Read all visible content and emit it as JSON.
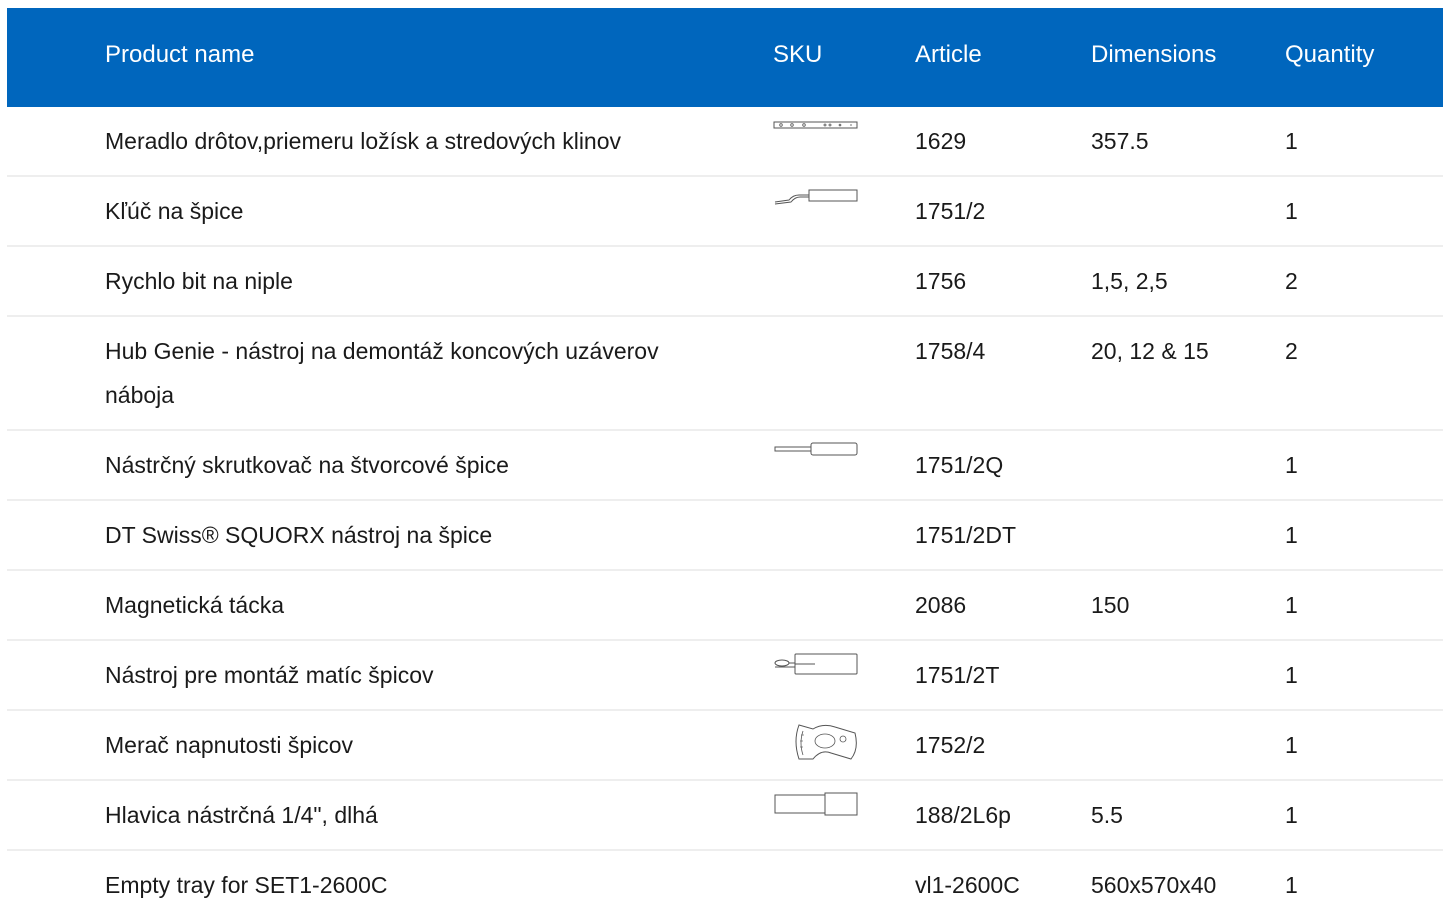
{
  "header": {
    "product_name": "Product name",
    "sku": "SKU",
    "article": "Article",
    "dimensions": "Dimensions",
    "quantity": "Quantity"
  },
  "colors": {
    "header_bg": "#0066bd",
    "header_text": "#ffffff",
    "row_divider": "#eeeeee"
  },
  "rows": [
    {
      "name": "Meradlo drôtov,priemeru ložísk a stredových klinov",
      "sku_icon": "ruler-gauge-icon",
      "article": "1629",
      "dimensions": "357.5",
      "quantity": "1"
    },
    {
      "name": "Kľúč na špice",
      "sku_icon": "spoke-wrench-icon",
      "article": "1751/2",
      "dimensions": "",
      "quantity": "1"
    },
    {
      "name": "Rychlo bit na niple",
      "sku_icon": "",
      "article": "1756",
      "dimensions": "1,5, 2,5",
      "quantity": "2"
    },
    {
      "name": "Hub Genie - nástroj na demontáž koncových uzáverov nábojа",
      "sku_icon": "",
      "article": "1758/4",
      "dimensions": "20, 12 & 15",
      "quantity": "2"
    },
    {
      "name": "Nástrčný skrutkovač na štvorcové špice",
      "sku_icon": "screwdriver-icon",
      "article": "1751/2Q",
      "dimensions": "",
      "quantity": "1"
    },
    {
      "name": "DT Swiss® SQUORX nástroj na špice",
      "sku_icon": "",
      "article": "1751/2DT",
      "dimensions": "",
      "quantity": "1"
    },
    {
      "name": "Magnetická tácka",
      "sku_icon": "",
      "article": "2086",
      "dimensions": "150",
      "quantity": "1"
    },
    {
      "name": "Nástroj pre montáž matíc špicov",
      "sku_icon": "nipple-tool-icon",
      "article": "1751/2T",
      "dimensions": "",
      "quantity": "1"
    },
    {
      "name": "Merač napnutosti špicov",
      "sku_icon": "tension-meter-icon",
      "article": "1752/2",
      "dimensions": "",
      "quantity": "1"
    },
    {
      "name": "Hlavica nástrčná 1/4\", dlhá",
      "sku_icon": "socket-icon",
      "article": "188/2L6p",
      "dimensions": "5.5",
      "quantity": "1"
    },
    {
      "name": "Empty tray for SET1-2600C",
      "sku_icon": "",
      "article": "vl1-2600C",
      "dimensions": "560x570x40",
      "quantity": "1"
    }
  ]
}
